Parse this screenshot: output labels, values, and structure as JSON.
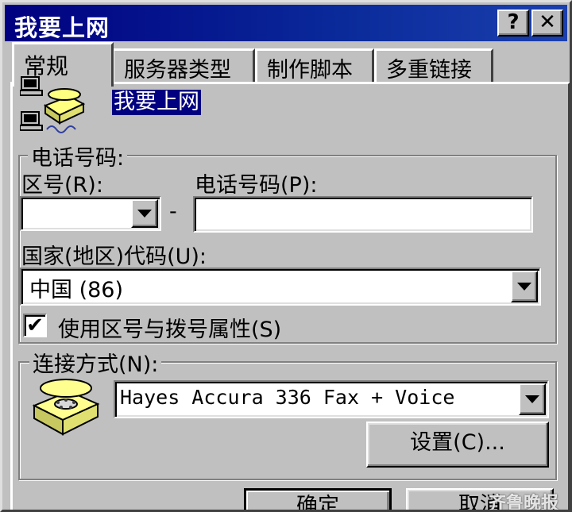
{
  "window": {
    "title": "我要上网",
    "help_label": "?",
    "close_label": "✕"
  },
  "tabs": [
    {
      "label": "常规",
      "active": true
    },
    {
      "label": "服务器类型",
      "active": false
    },
    {
      "label": "制作脚本",
      "active": false
    },
    {
      "label": "多重链接",
      "active": false
    }
  ],
  "connection": {
    "name": "我要上网",
    "icon": "network-computers-phone-icon"
  },
  "phone_group": {
    "legend": "电话号码:",
    "area_code_label": "区号(R):",
    "area_code_value": "",
    "separator": "-",
    "phone_label": "电话号码(P):",
    "phone_value": "",
    "country_label": "国家(地区)代码(U):",
    "country_value": "中国 (86)",
    "use_area_code_label": "使用区号与拨号属性(S)",
    "use_area_code_checked": "✔"
  },
  "connect_group": {
    "legend": "连接方式(N):",
    "device_icon": "telephone-icon",
    "device_value": "Hayes Accura 336 Fax + Voice",
    "configure_label": "设置(C)..."
  },
  "footer": {
    "ok_label": "确定",
    "cancel_label": "取消"
  },
  "watermark": "齐鲁晚报"
}
